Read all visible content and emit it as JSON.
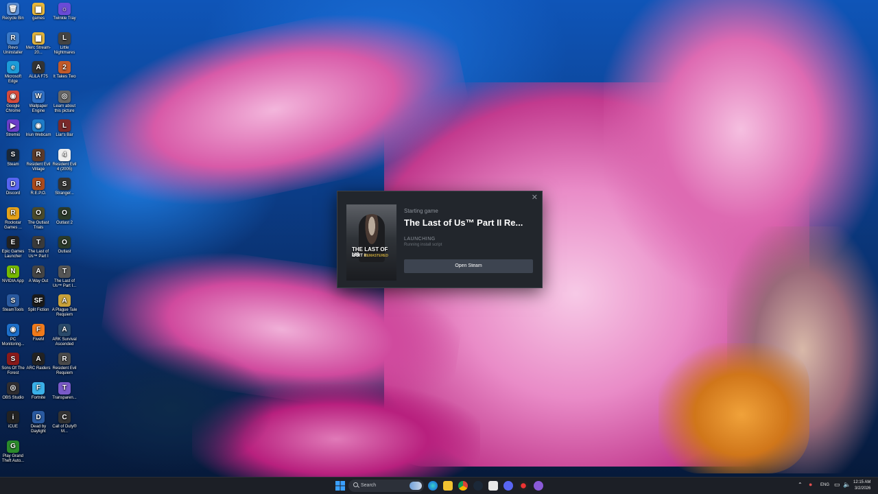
{
  "desktop_icons": [
    {
      "label": "Recycle Bin",
      "color": "#5b8fd6",
      "glyph": "🗑"
    },
    {
      "label": "games",
      "color": "#e8b73a",
      "glyph": "▆"
    },
    {
      "label": "Twinkle Tray",
      "color": "#6a4bd6",
      "glyph": "☼"
    },
    {
      "label": "Revo Uninstaller",
      "color": "#3a79c7",
      "glyph": "R"
    },
    {
      "label": "Merc Stream-20...",
      "color": "#e0b33c",
      "glyph": "▆"
    },
    {
      "label": "Little Nightmares",
      "color": "#444",
      "glyph": "L"
    },
    {
      "label": "Microsoft Edge",
      "color": "#1c9bd8",
      "glyph": "e"
    },
    {
      "label": "ALiLA F75",
      "color": "#333",
      "glyph": "A"
    },
    {
      "label": "It Takes Two",
      "color": "#c25a2a",
      "glyph": "2"
    },
    {
      "label": "Google Chrome",
      "color": "#d64b3c",
      "glyph": "◉"
    },
    {
      "label": "Wallpaper Engine",
      "color": "#2f6fc4",
      "glyph": "W"
    },
    {
      "label": "Learn about this picture",
      "color": "#666",
      "glyph": "◎"
    },
    {
      "label": "Stremio",
      "color": "#6b3ec9",
      "glyph": "▶"
    },
    {
      "label": "Iriun Webcam",
      "color": "#1e7cc9",
      "glyph": "◉"
    },
    {
      "label": "Liar's Bar",
      "color": "#7a2a2a",
      "glyph": "L"
    },
    {
      "label": "Steam",
      "color": "#1b2838",
      "glyph": "S"
    },
    {
      "label": "Resident Evil Village",
      "color": "#5a3a2a",
      "glyph": "R"
    },
    {
      "label": "Resident Evil 4 (2005)",
      "color": "#eee",
      "glyph": "4"
    },
    {
      "label": "Discord",
      "color": "#5865f2",
      "glyph": "D"
    },
    {
      "label": "R.E.P.O.",
      "color": "#a84a1c",
      "glyph": "R"
    },
    {
      "label": "Stranger...",
      "color": "#333",
      "glyph": "S"
    },
    {
      "label": "Rockstar Games ...",
      "color": "#e4a21a",
      "glyph": "R"
    },
    {
      "label": "The Outlast Trials",
      "color": "#4a4a2a",
      "glyph": "O"
    },
    {
      "label": "Outlast 2",
      "color": "#2a3a2a",
      "glyph": "O"
    },
    {
      "label": "Epic Games Launcher",
      "color": "#222",
      "glyph": "E"
    },
    {
      "label": "The Last of Us™ Part I",
      "color": "#3a3a3a",
      "glyph": "T"
    },
    {
      "label": "Outlast",
      "color": "#2a3a2a",
      "glyph": "O"
    },
    {
      "label": "NVIDIA App",
      "color": "#76b900",
      "glyph": "N"
    },
    {
      "label": "A Way Out",
      "color": "#444",
      "glyph": "A"
    },
    {
      "label": "The Last of Us™ Part I...",
      "color": "#555",
      "glyph": "T"
    },
    {
      "label": "SteamTools",
      "color": "#2a5aa0",
      "glyph": "S"
    },
    {
      "label": "Split Fiction",
      "color": "#1a1a1a",
      "glyph": "SF"
    },
    {
      "label": "A Plague Tale Requiem",
      "color": "#c9a23a",
      "glyph": "A"
    },
    {
      "label": "PC Monitoring...",
      "color": "#1d6fc9",
      "glyph": "◉"
    },
    {
      "label": "FiveM",
      "color": "#f07a1a",
      "glyph": "F"
    },
    {
      "label": "ARK Survival Ascended",
      "color": "#2a4a6a",
      "glyph": "A"
    },
    {
      "label": "Sons Of The Forest",
      "color": "#8a1a1a",
      "glyph": "S"
    },
    {
      "label": "ARC Raiders",
      "color": "#222",
      "glyph": "A"
    },
    {
      "label": "Resident Evil Requiem",
      "color": "#4a4a4a",
      "glyph": "R"
    },
    {
      "label": "OBS Studio",
      "color": "#302e31",
      "glyph": "◎"
    },
    {
      "label": "Fortnite",
      "color": "#3ab0e8",
      "glyph": "F"
    },
    {
      "label": "Transparen...",
      "color": "#7a5ac9",
      "glyph": "T"
    },
    {
      "label": "iCUE",
      "color": "#222",
      "glyph": "i"
    },
    {
      "label": "Dead by Daylight",
      "color": "#2a5aa0",
      "glyph": "D"
    },
    {
      "label": "Call of Duty® M...",
      "color": "#333",
      "glyph": "C"
    },
    {
      "label": "Play Grand Theft Auto...",
      "color": "#2a8a2a",
      "glyph": "G"
    }
  ],
  "dialog": {
    "starting": "Starting game",
    "title": "The Last of Us™ Part II Re...",
    "status": "LAUNCHING",
    "sub": "Running install script",
    "button": "Open Steam",
    "cover_line1": "THE LAST OF US",
    "cover_line2": "PART II",
    "cover_line3": "REMASTERED"
  },
  "taskbar": {
    "search_placeholder": "Search",
    "tray_lang": "ENG",
    "clock_time": "12:15 AM",
    "clock_date": "3/2/2026"
  }
}
